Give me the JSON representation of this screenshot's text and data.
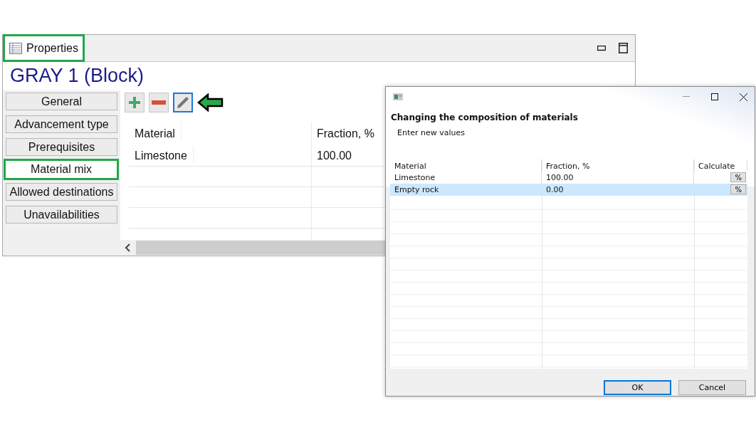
{
  "properties_window": {
    "title": "Properties",
    "title_annotated": true,
    "heading": "GRAY 1 (Block)",
    "tabs": [
      {
        "label": "General",
        "selected": false,
        "annotated": false
      },
      {
        "label": "Advancement type",
        "selected": false,
        "annotated": false
      },
      {
        "label": "Prerequisites",
        "selected": false,
        "annotated": false
      },
      {
        "label": "Material mix",
        "selected": true,
        "annotated": true
      },
      {
        "label": "Allowed destinations",
        "selected": false,
        "annotated": false
      },
      {
        "label": "Unavailabilities",
        "selected": false,
        "annotated": false
      }
    ],
    "toolbar": [
      {
        "kind": "add",
        "annotated": false
      },
      {
        "kind": "remove",
        "annotated": false
      },
      {
        "kind": "edit",
        "annotated": true
      }
    ],
    "table": {
      "columns": [
        "Material",
        "Fraction, %"
      ],
      "rows": [
        [
          "Limestone",
          "100.00"
        ]
      ]
    }
  },
  "dialog": {
    "heading": "Changing the composition of materials",
    "subtitle": "Enter new values",
    "table": {
      "columns": [
        "Material",
        "Fraction, %",
        "Calculate"
      ],
      "rows": [
        {
          "material": "Limestone",
          "fraction": "100.00",
          "button": "%",
          "selected": false
        },
        {
          "material": "Empty rock",
          "fraction": "0.00",
          "button": "%",
          "selected": true
        }
      ]
    },
    "buttons": [
      {
        "label": "OK",
        "default": true
      },
      {
        "label": "Cancel",
        "default": false
      }
    ]
  }
}
